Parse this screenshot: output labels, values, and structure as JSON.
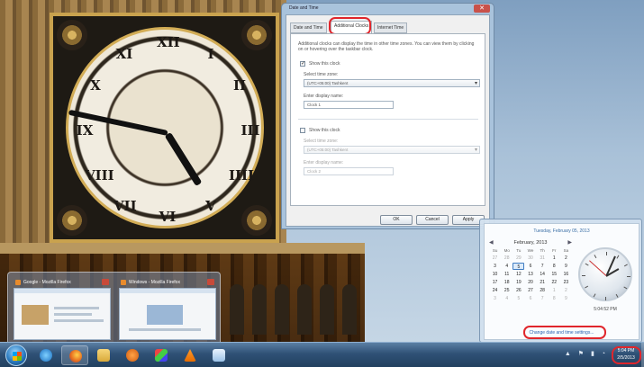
{
  "dialog": {
    "title": "Date and Time",
    "tabs": [
      "Date and Time",
      "Additional Clocks",
      "Internet Time"
    ],
    "active_tab": "Additional Clocks",
    "description": "Additional clocks can display the time in other time zones. You can view them by clicking on or hovering over the taskbar clock.",
    "clock1": {
      "show_label": "Show this clock",
      "checked": true,
      "timezone_label": "Select time zone:",
      "timezone_value": "(UTC+05:00) Tashkent",
      "name_label": "Enter display name:",
      "name_value": "Clock 1"
    },
    "clock2": {
      "show_label": "Show this clock",
      "checked": false,
      "timezone_label": "Select time zone:",
      "timezone_value": "(UTC+05:00) Tashkent",
      "name_label": "Enter display name:",
      "name_value": "Clock 2"
    },
    "buttons": {
      "ok": "OK",
      "cancel": "Cancel",
      "apply": "Apply"
    },
    "close_glyph": "✕"
  },
  "flyout": {
    "date_long": "Tuesday, February 05, 2013",
    "month_label": "February, 2013",
    "prev_glyph": "◀",
    "next_glyph": "▶",
    "weekdays": [
      "Su",
      "Mo",
      "Tu",
      "We",
      "Th",
      "Fr",
      "Sa"
    ],
    "days": [
      {
        "d": "27",
        "other": true
      },
      {
        "d": "28",
        "other": true
      },
      {
        "d": "29",
        "other": true
      },
      {
        "d": "30",
        "other": true
      },
      {
        "d": "31",
        "other": true
      },
      {
        "d": "1"
      },
      {
        "d": "2"
      },
      {
        "d": "3"
      },
      {
        "d": "4"
      },
      {
        "d": "5",
        "today": true
      },
      {
        "d": "6"
      },
      {
        "d": "7"
      },
      {
        "d": "8"
      },
      {
        "d": "9"
      },
      {
        "d": "10"
      },
      {
        "d": "11"
      },
      {
        "d": "12"
      },
      {
        "d": "13"
      },
      {
        "d": "14"
      },
      {
        "d": "15"
      },
      {
        "d": "16"
      },
      {
        "d": "17"
      },
      {
        "d": "18"
      },
      {
        "d": "19"
      },
      {
        "d": "20"
      },
      {
        "d": "21"
      },
      {
        "d": "22"
      },
      {
        "d": "23"
      },
      {
        "d": "24"
      },
      {
        "d": "25"
      },
      {
        "d": "26"
      },
      {
        "d": "27"
      },
      {
        "d": "28"
      },
      {
        "d": "1",
        "other": true
      },
      {
        "d": "2",
        "other": true
      },
      {
        "d": "3",
        "other": true
      },
      {
        "d": "4",
        "other": true
      },
      {
        "d": "5",
        "other": true
      },
      {
        "d": "6",
        "other": true
      },
      {
        "d": "7",
        "other": true
      },
      {
        "d": "8",
        "other": true
      },
      {
        "d": "9",
        "other": true
      }
    ],
    "time": "5:04:52 PM",
    "change_link": "Change date and time settings..."
  },
  "taskbar": {
    "clock_time": "5:04 PM",
    "clock_date": "2/5/2013",
    "tray_glyphs": "▲ ⚑ ▮ ◔"
  },
  "thumbnails": [
    {
      "title": "Google - Mozilla Firefox"
    },
    {
      "title": "Windows - Mozilla Firefox"
    }
  ],
  "colors": {
    "highlight": "#e0262c",
    "accent": "#3a6ea5",
    "taskbar": "#2f5176"
  },
  "icons": [
    "windows-logo-icon",
    "internet-explorer-icon",
    "firefox-icon",
    "folder-icon",
    "media-player-icon",
    "paint-icon",
    "vlc-icon",
    "notepad-icon"
  ]
}
